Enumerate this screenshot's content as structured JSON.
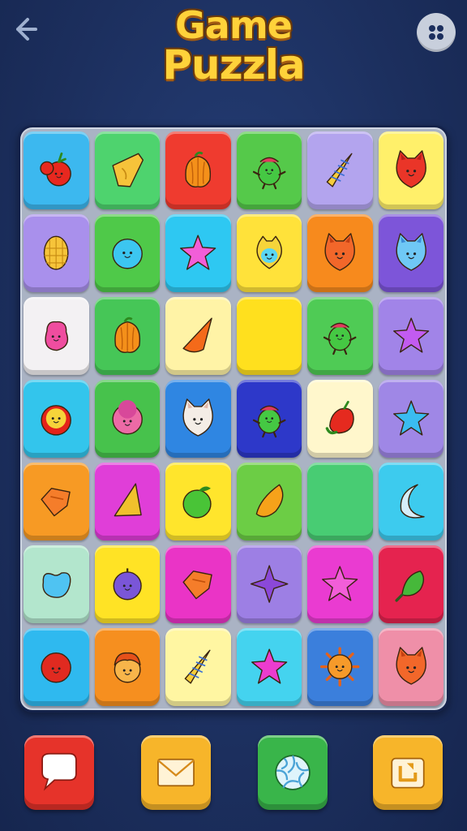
{
  "header": {
    "title_line1": "Game",
    "title_line2": "Puzzla"
  },
  "icons": {
    "back": "back-arrow-icon",
    "menu": "dots-menu-icon"
  },
  "colors": {
    "background": "#1f3466",
    "title": "#ffd23a",
    "board": "#aab3c4"
  },
  "board": {
    "rows": 7,
    "cols": 6,
    "tiles": [
      {
        "bg": "#3cb8ef",
        "piece": "cherry-tomato"
      },
      {
        "bg": "#4ed36e",
        "piece": "cheese-wedge"
      },
      {
        "bg": "#ef3b2f",
        "piece": "orange-leaf"
      },
      {
        "bg": "#55c94a",
        "piece": "green-creature"
      },
      {
        "bg": "#b3a4ee",
        "piece": "corn-cone"
      },
      {
        "bg": "#fff06a",
        "piece": "red-cat-face"
      },
      {
        "bg": "#a990ec",
        "piece": "corn-cob"
      },
      {
        "bg": "#4fc949",
        "piece": "blue-ball-face"
      },
      {
        "bg": "#2ec8f2",
        "piece": "pink-star"
      },
      {
        "bg": "#ffe23a",
        "piece": "yellow-face"
      },
      {
        "bg": "#f78a1d",
        "piece": "orange-cat-face"
      },
      {
        "bg": "#7d55d9",
        "piece": "blue-cat-face"
      },
      {
        "bg": "#f3f1f3",
        "piece": "pink-blob"
      },
      {
        "bg": "#46c657",
        "piece": "orange-leaf"
      },
      {
        "bg": "#fff3a6",
        "piece": "orange-cone"
      },
      {
        "bg": "#ffe01e",
        "piece": "empty"
      },
      {
        "bg": "#4fcb55",
        "piece": "green-creature"
      },
      {
        "bg": "#a184e8",
        "piece": "purple-star"
      },
      {
        "bg": "#33c5ec",
        "piece": "yellow-lion-face"
      },
      {
        "bg": "#47c24c",
        "piece": "pink-fluffy-face"
      },
      {
        "bg": "#2f86e2",
        "piece": "white-cat-face"
      },
      {
        "bg": "#2d38c9",
        "piece": "green-creature"
      },
      {
        "bg": "#fff7cc",
        "piece": "red-pepper"
      },
      {
        "bg": "#9f87e6",
        "piece": "blue-star"
      },
      {
        "bg": "#f79a24",
        "piece": "orange-shield"
      },
      {
        "bg": "#e03ed8",
        "piece": "yellow-cone"
      },
      {
        "bg": "#ffe52c",
        "piece": "green-apple"
      },
      {
        "bg": "#6ccd45",
        "piece": "orange-leaf-drop"
      },
      {
        "bg": "#48cc73",
        "piece": "empty"
      },
      {
        "bg": "#3dcbee",
        "piece": "blue-crescent"
      },
      {
        "bg": "#b3e6cd",
        "piece": "blue-bean"
      },
      {
        "bg": "#ffe325",
        "piece": "purple-ball-face"
      },
      {
        "bg": "#ea34c6",
        "piece": "orange-shield"
      },
      {
        "bg": "#9d7fe4",
        "piece": "purple-star4"
      },
      {
        "bg": "#ea3bd1",
        "piece": "pink-star"
      },
      {
        "bg": "#e5234f",
        "piece": "green-pepper"
      },
      {
        "bg": "#2fb9ef",
        "piece": "red-berry-face"
      },
      {
        "bg": "#f68f1f",
        "piece": "orange-hair-face"
      },
      {
        "bg": "#fff6a2",
        "piece": "corn-cone"
      },
      {
        "bg": "#44d3ef",
        "piece": "magenta-star"
      },
      {
        "bg": "#3b7fdc",
        "piece": "sun-face"
      },
      {
        "bg": "#ef8fa8",
        "piece": "orange-cat-face"
      }
    ]
  },
  "bottom_bar": {
    "buttons": [
      {
        "name": "chat-button",
        "icon": "speech-bubble-icon",
        "bg": "#e6332a"
      },
      {
        "name": "mail-button",
        "icon": "envelope-icon",
        "bg": "#f7b52a"
      },
      {
        "name": "shutter-button",
        "icon": "shutter-icon",
        "bg": "#39b54a"
      },
      {
        "name": "share-button",
        "icon": "share-box-icon",
        "bg": "#f7b52a"
      }
    ]
  }
}
